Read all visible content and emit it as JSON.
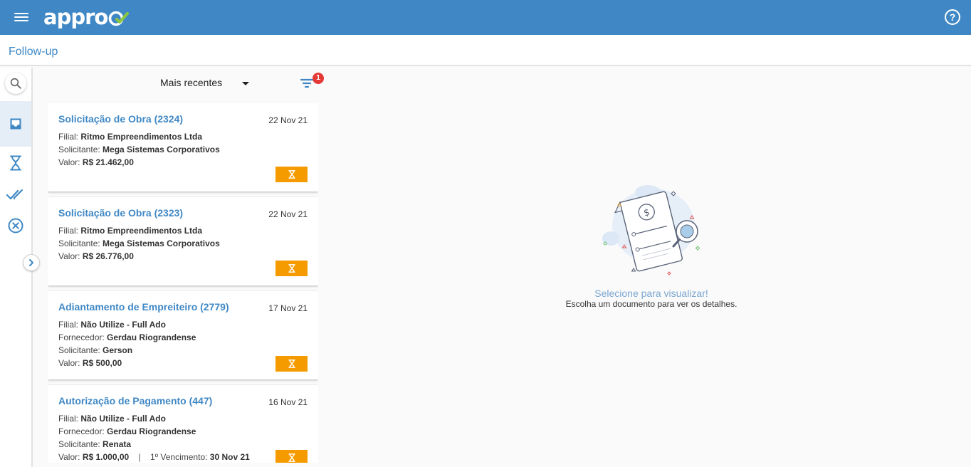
{
  "app": {
    "logo_text": "appro",
    "page_title": "Follow-up"
  },
  "toolbar": {
    "sort_label": "Mais recentes",
    "filter_count": "1"
  },
  "cards": [
    {
      "title": "Solicitação de Obra (2324)",
      "date": "22 Nov 21",
      "lines": [
        {
          "label": "Filial:",
          "value": "Ritmo Empreendimentos Ltda"
        },
        {
          "label": "Solicitante:",
          "value": "Mega Sistemas Corporativos"
        },
        {
          "label": "Valor:",
          "value": "R$ 21.462,00"
        }
      ]
    },
    {
      "title": "Solicitação de Obra (2323)",
      "date": "22 Nov 21",
      "lines": [
        {
          "label": "Filial:",
          "value": "Ritmo Empreendimentos Ltda"
        },
        {
          "label": "Solicitante:",
          "value": "Mega Sistemas Corporativos"
        },
        {
          "label": "Valor:",
          "value": "R$ 26.776,00"
        }
      ]
    },
    {
      "title": "Adiantamento de Empreiteiro (2779)",
      "date": "17 Nov 21",
      "lines": [
        {
          "label": "Filial:",
          "value": "Não Utilize - Full Ado"
        },
        {
          "label": "Fornecedor:",
          "value": "Gerdau Riograndense"
        },
        {
          "label": "Solicitante:",
          "value": "Gerson"
        },
        {
          "label": "Valor:",
          "value": "R$ 500,00"
        }
      ]
    },
    {
      "title": "Autorização de Pagamento (447)",
      "date": "16 Nov 21",
      "lines": [
        {
          "label": "Filial:",
          "value": "Não Utilize - Full Ado"
        },
        {
          "label": "Fornecedor:",
          "value": "Gerdau Riograndense"
        },
        {
          "label": "Solicitante:",
          "value": "Renata"
        },
        {
          "label": "Valor:",
          "value": "R$ 1.000,00"
        }
      ],
      "extra": {
        "separator": "|",
        "label": "1º Vencimento:",
        "value": "30 Nov 21"
      }
    }
  ],
  "empty_state": {
    "title": "Selecione para visualizar!",
    "subtitle": "Escolha um documento para ver os detalhes."
  },
  "colors": {
    "primary": "#3f88c5",
    "accent_green": "#8dc63f",
    "status_pending": "#f59b00",
    "badge": "#e53935"
  },
  "icons": {
    "menu": "hamburger-icon",
    "help": "help-circle-icon",
    "search": "search-icon",
    "inbox": "inbox-icon",
    "pending": "hourglass-icon",
    "approved": "double-check-icon",
    "rejected": "cancel-circle-icon",
    "expand": "chevron-right-icon",
    "sort": "caret-down-icon",
    "filter": "filter-icon"
  }
}
